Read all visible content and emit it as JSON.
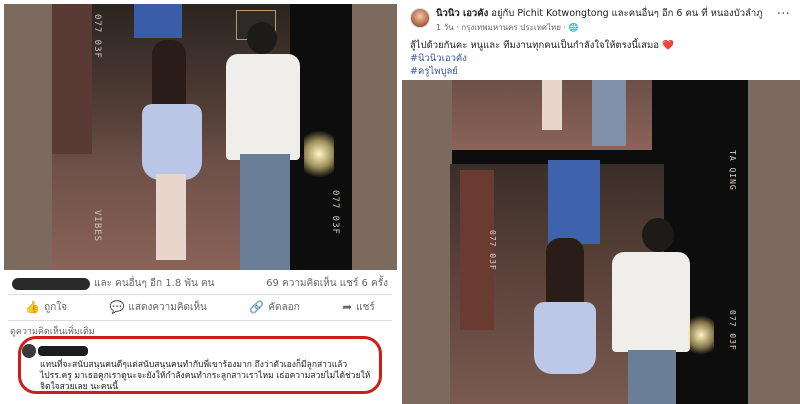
{
  "left_post": {
    "film_labels": {
      "top_code": "077 03F",
      "bottom_code": "077 03F",
      "brand": "VIBES"
    },
    "reactions_text": "และ คนอื่นๆ อีก 1.8 พัน คน",
    "counts_text": "69 ความคิดเห็น   แชร์ 6 ครั้ง",
    "actions": [
      {
        "label": "ถูกใจ",
        "icon": "👍"
      },
      {
        "label": "แสดงความคิดเห็น",
        "icon": "💬"
      },
      {
        "label": "คัดลอก",
        "icon": "🔗"
      },
      {
        "label": "แชร์",
        "icon": "➦"
      }
    ],
    "comment_section_label": "ดูความคิดเห็นเพิ่มเติม",
    "comment_text": "แทนที่จะสนับสนุนคนดีๆแต่สนับสนุนคนทำกับพี่เขาร้องมาก ถึงว่าตัวเองก็มีลูกสาวแล้วไปรร.ครู มาเธอคูกเราดูนะจะยังให้กำลังคนทำกระลูกสาวเราไหม เธ่อความสวยไม่ได้ช่วยให้จิตใจสวยเลย นะคนนี้"
  },
  "right_post": {
    "author_line": "นิวนิว เอวคัง",
    "with_text": "อยู่กับ Pichit Kotwongtong และคนอื่นๆ อีก 6 คน ที่ หนองบัวลำภู",
    "sub_line": "1 วัน · กรุงเทพมหานคร ประเทศไทย · 🌐",
    "more_icon": "···",
    "post_text": "สู้ไปด้วยกันคะ หนูและ ทีมงานทุกคนเป็นกำลังใจให้ตรงนี้เสมอ",
    "heart": "❤️",
    "hashtags": [
      "#นิวนิวเอวคัง",
      "#ครูไพบูลย์"
    ],
    "film_labels": {
      "side_code_top": "077 03F",
      "side_code_bottom": "077 03F",
      "brand": "TA QING"
    }
  }
}
